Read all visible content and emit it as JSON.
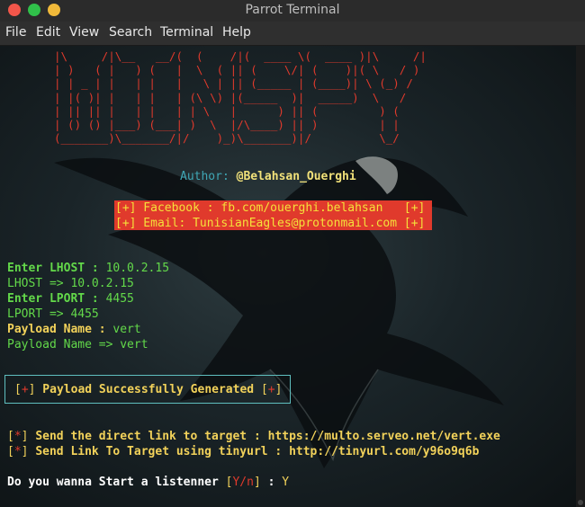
{
  "window": {
    "title": "Parrot Terminal"
  },
  "menu": [
    "File",
    "Edit",
    "View",
    "Search",
    "Terminal",
    "Help"
  ],
  "banner": {
    "ascii": [
      "|\\     /|\\__   __/(  (    /|(  ____ \\(  ____ )|\\     /|",
      "| )   ( |   ) (   |  \\  ( || (    \\/| (    )|( \\   / )",
      "| | _ | |   | |   |   \\ | || (_____ | (____)| \\ (_) / ",
      "| |( )| |   | |   | (\\ \\) |(_____  )|  _____)  \\   /  ",
      "| || || |   | |   | | \\   |      ) || (         ) (   ",
      "| () () |___) (___| )  \\  |/\\____) || )         | |   ",
      "(_______)\\_______/|/    )_)\\_______)|/          \\_/   "
    ],
    "author_label": "Author: ",
    "author_name": "@Belahsan_Ouerghi",
    "facebook_line": "[+] Facebook : fb.com/ouerghi.belahsan   [+]",
    "email_line": "[+] Email: TunisianEagles@protonmail.com [+]"
  },
  "prompts": {
    "lhost_label": "Enter LHOST : ",
    "lhost_value": "10.0.2.15",
    "lhost_echo": "LHOST => 10.0.2.15",
    "lport_label": "Enter LPORT : ",
    "lport_value": "4455",
    "lport_echo": "LPORT => 4455",
    "payload_label": "Payload Name : ",
    "payload_value": "vert",
    "payload_echo": "Payload Name => vert"
  },
  "success": {
    "open": "[",
    "plus": "+",
    "close": "]",
    "message": " Payload Successfully Generated "
  },
  "links": {
    "marker": "*",
    "direct_text": "Send the direct link to target : https://multo.serveo.net/vert.exe",
    "tiny_text": "Send Link To Target using tinyurl : http://tinyurl.com/y96o9q6b"
  },
  "listener": {
    "question": "Do you wanna Start a listenner ",
    "options_open": "[",
    "options": "Y/n",
    "options_close": "]",
    "sep": " : ",
    "answer": "Y"
  }
}
